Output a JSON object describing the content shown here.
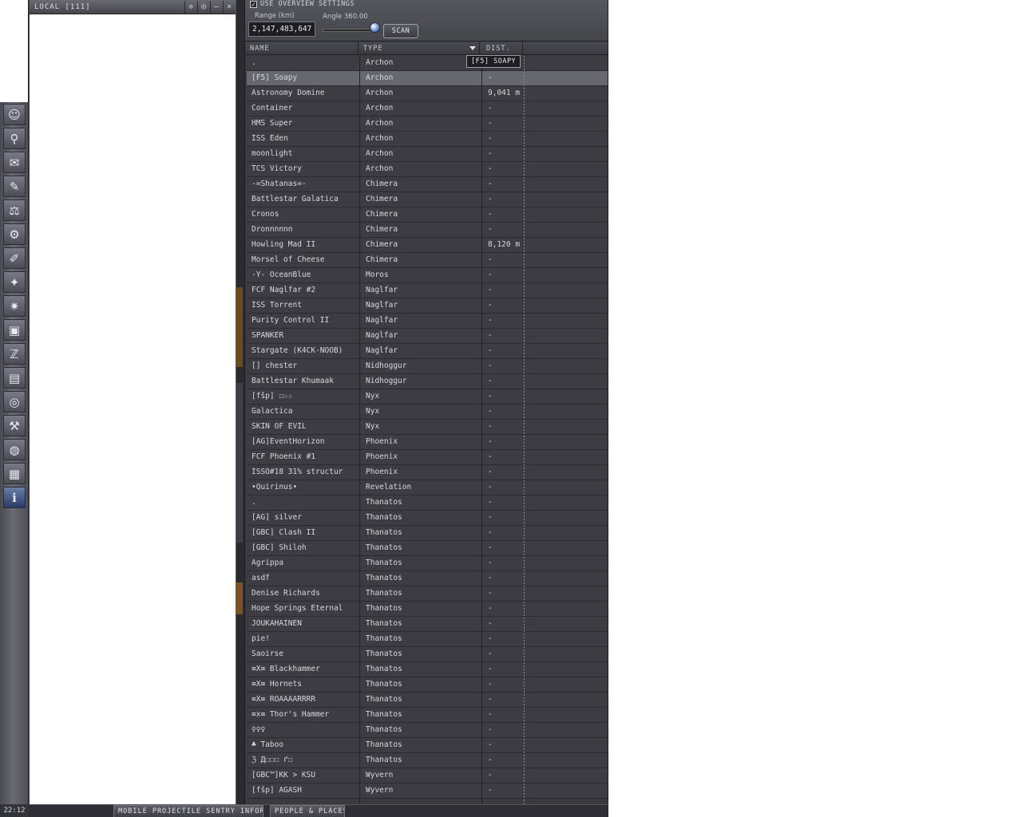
{
  "neocom": {
    "clock": "22:12",
    "buttons": [
      {
        "icon": "character-icon",
        "glyph": "☺"
      },
      {
        "icon": "people-icon",
        "glyph": "⚲"
      },
      {
        "icon": "mail-icon",
        "glyph": "✉"
      },
      {
        "icon": "notepad-icon",
        "glyph": "✎"
      },
      {
        "icon": "market-icon",
        "glyph": "⚖"
      },
      {
        "icon": "industry-icon",
        "glyph": "⚙"
      },
      {
        "icon": "journal-icon",
        "glyph": "✐"
      },
      {
        "icon": "map-icon",
        "glyph": "✦"
      },
      {
        "icon": "corporation-icon",
        "glyph": "✷"
      },
      {
        "icon": "assets-icon",
        "glyph": "▣"
      },
      {
        "icon": "wallet-icon",
        "glyph": "ℤ"
      },
      {
        "icon": "calculator-icon",
        "glyph": "▤"
      },
      {
        "icon": "help-lifebuoy-icon",
        "glyph": "◎"
      },
      {
        "icon": "fitting-icon",
        "glyph": "⚒"
      },
      {
        "icon": "browser-icon",
        "glyph": "◍"
      },
      {
        "icon": "logbook-icon",
        "glyph": "▦"
      },
      {
        "icon": "info-icon",
        "glyph": "ℹ"
      }
    ]
  },
  "local": {
    "title": "LOCAL [111]",
    "controls": [
      "✲",
      "◎",
      "–",
      "×"
    ]
  },
  "overview": {
    "use_settings_label": "USE OVERVIEW SETTINGS",
    "range_label": "Range (km)",
    "range_value": "2,147,483,647",
    "angle_label": "Angle 360.00",
    "scan_label": "SCAN",
    "columns": {
      "name": "NAME",
      "type": "TYPE",
      "dist": "DIST."
    },
    "tooltip": "[F5] SOAPY",
    "rows": [
      {
        "name": ".",
        "type": "Archon",
        "dist": "-"
      },
      {
        "name": "[F5] Soapy",
        "type": "Archon",
        "dist": "-"
      },
      {
        "name": "Astronomy Domine",
        "type": "Archon",
        "dist": "9,041 m"
      },
      {
        "name": "Container",
        "type": "Archon",
        "dist": "-"
      },
      {
        "name": "HMS Super",
        "type": "Archon",
        "dist": "-"
      },
      {
        "name": "ISS Eden",
        "type": "Archon",
        "dist": "-"
      },
      {
        "name": "moonlight",
        "type": "Archon",
        "dist": "-"
      },
      {
        "name": "TCS Victory",
        "type": "Archon",
        "dist": "-"
      },
      {
        "name": "-=Shatanas=-",
        "type": "Chimera",
        "dist": "-"
      },
      {
        "name": "Battlestar Galatica",
        "type": "Chimera",
        "dist": "-"
      },
      {
        "name": "Cronos",
        "type": "Chimera",
        "dist": "-"
      },
      {
        "name": "Dronnnnnn",
        "type": "Chimera",
        "dist": "-"
      },
      {
        "name": "Howling Mad II",
        "type": "Chimera",
        "dist": "8,120 m"
      },
      {
        "name": "Morsel of Cheese",
        "type": "Chimera",
        "dist": "-"
      },
      {
        "name": "-Y- OceanBlue",
        "type": "Moros",
        "dist": "-"
      },
      {
        "name": "FCF Naglfar #2",
        "type": "Naglfar",
        "dist": "-"
      },
      {
        "name": "ISS Torrent",
        "type": "Naglfar",
        "dist": "-"
      },
      {
        "name": "Purity Control II",
        "type": "Naglfar",
        "dist": "-"
      },
      {
        "name": "SPANKER",
        "type": "Naglfar",
        "dist": "-"
      },
      {
        "name": "Stargate (K4CK-NOOB)",
        "type": "Naglfar",
        "dist": "-"
      },
      {
        "name": "[] chester",
        "type": "Nidhoggur",
        "dist": "-"
      },
      {
        "name": "Battlestar Khumaak",
        "type": "Nidhoggur",
        "dist": "-"
      },
      {
        "name": "[fšp] ☐☆☆",
        "type": "Nyx",
        "dist": "-"
      },
      {
        "name": "Galactica",
        "type": "Nyx",
        "dist": "-"
      },
      {
        "name": "SKIN OF EVIL",
        "type": "Nyx",
        "dist": "-"
      },
      {
        "name": "[AG]EventHorizon",
        "type": "Phoenix",
        "dist": "-"
      },
      {
        "name": "FCF Phoenix #1",
        "type": "Phoenix",
        "dist": "-"
      },
      {
        "name": "ISSO#18 31% structur",
        "type": "Phoenix",
        "dist": "-"
      },
      {
        "name": "•Quirinus•",
        "type": "Revelation",
        "dist": "-"
      },
      {
        "name": ".",
        "type": "Thanatos",
        "dist": "-"
      },
      {
        "name": "[AG] silver",
        "type": "Thanatos",
        "dist": "-"
      },
      {
        "name": "[GBC] Clash II",
        "type": "Thanatos",
        "dist": "-"
      },
      {
        "name": "[GBC] Shiloh",
        "type": "Thanatos",
        "dist": "-"
      },
      {
        "name": "Agrippa",
        "type": "Thanatos",
        "dist": "-"
      },
      {
        "name": "asdf",
        "type": "Thanatos",
        "dist": "-"
      },
      {
        "name": "Denise Richards",
        "type": "Thanatos",
        "dist": "-"
      },
      {
        "name": "Hope Springs Eternal",
        "type": "Thanatos",
        "dist": "-"
      },
      {
        "name": "JOUKAHAINEN",
        "type": "Thanatos",
        "dist": "-"
      },
      {
        "name": "pie!",
        "type": "Thanatos",
        "dist": "-"
      },
      {
        "name": "Saoirse",
        "type": "Thanatos",
        "dist": "-"
      },
      {
        "name": "≡X≡ Blackhammer",
        "type": "Thanatos",
        "dist": "-"
      },
      {
        "name": "≡X≡ Hornets",
        "type": "Thanatos",
        "dist": "-"
      },
      {
        "name": "≡X≡ ROAAAARRRR",
        "type": "Thanatos",
        "dist": "-"
      },
      {
        "name": "≡x≡ Thor's Hammer",
        "type": "Thanatos",
        "dist": "-"
      },
      {
        "name": "♀♀♀",
        "type": "Thanatos",
        "dist": "-"
      },
      {
        "name": "♣ Taboo",
        "type": "Thanatos",
        "dist": "-"
      },
      {
        "name": "ℨ Д☐☐☐ ґ☐",
        "type": "Thanatos",
        "dist": "-"
      },
      {
        "name": "[GBC™]KK > KSU",
        "type": "Wyvern",
        "dist": "-"
      },
      {
        "name": "[fšp] AGASH",
        "type": "Wyvern",
        "dist": "-"
      }
    ],
    "selected_index": 1
  },
  "taskbar": {
    "items": [
      {
        "label": "MOBILE PROJECTILE SENTRY INFORMA..."
      },
      {
        "label": "PEOPLE & PLACES"
      }
    ]
  },
  "colors": {
    "panel_bg": "#3c3c42",
    "selected_row": "#67676f",
    "text": "#d8d8e2"
  }
}
